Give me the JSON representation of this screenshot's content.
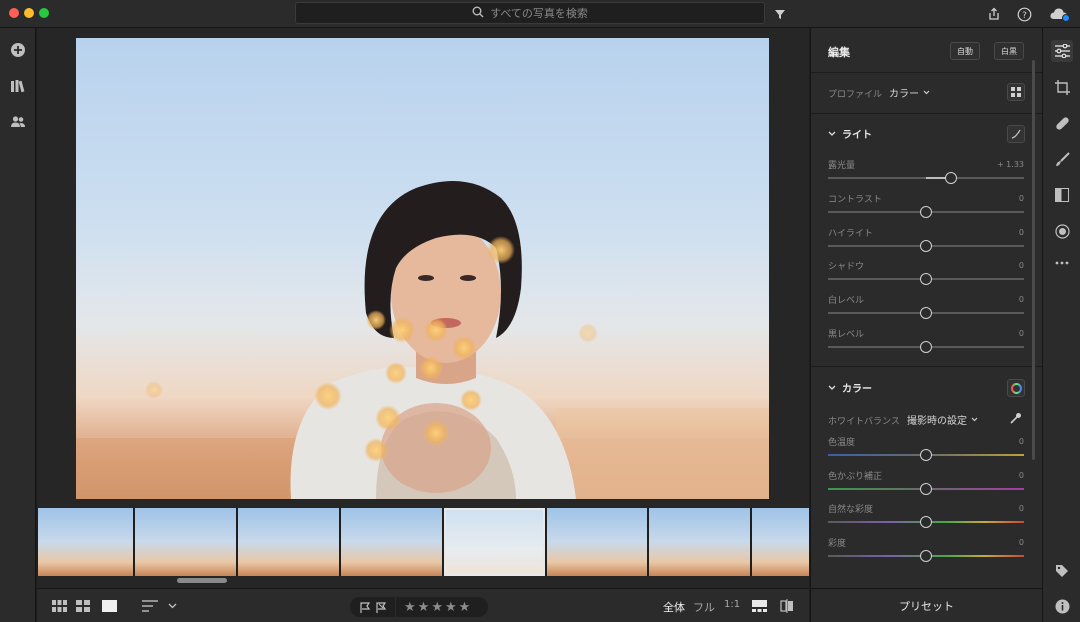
{
  "search": {
    "placeholder": "すべての写真を検索"
  },
  "colors": {
    "panel": "#2b2b2b",
    "accent": "#e8e8e8",
    "red": "#fe5f57",
    "yellow": "#febc2e",
    "green": "#28c840"
  },
  "edit_panel": {
    "title": "編集",
    "auto_label": "自動",
    "bw_label": "白黒",
    "profile_label": "プロファイル",
    "profile_value": "カラー",
    "light_section": {
      "title": "ライト",
      "sliders": [
        {
          "label": "露光量",
          "value": "+ 1.33",
          "position": 0.63
        },
        {
          "label": "コントラスト",
          "value": "0",
          "position": 0.5
        },
        {
          "label": "ハイライト",
          "value": "0",
          "position": 0.5
        },
        {
          "label": "シャドウ",
          "value": "0",
          "position": 0.5
        },
        {
          "label": "白レベル",
          "value": "0",
          "position": 0.5
        },
        {
          "label": "黒レベル",
          "value": "0",
          "position": 0.5
        }
      ]
    },
    "color_section": {
      "title": "カラー",
      "wb_label": "ホワイトバランス",
      "wb_value": "撮影時の設定",
      "sliders": [
        {
          "label": "色温度",
          "value": "0",
          "position": 0.5
        },
        {
          "label": "色かぶり補正",
          "value": "0",
          "position": 0.5
        },
        {
          "label": "自然な彩度",
          "value": "0",
          "position": 0.5
        },
        {
          "label": "彩度",
          "value": "0",
          "position": 0.5
        }
      ]
    }
  },
  "preset_label": "プリセット",
  "bottom": {
    "zoom_fit": "全体",
    "zoom_full": "フル",
    "zoom_1to1": "1:1"
  },
  "icons": {
    "left_rail": [
      "add-icon",
      "library-icon",
      "people-icon"
    ],
    "right_rail": [
      "sliders-icon",
      "crop-icon",
      "healing-icon",
      "brush-icon",
      "gradient-icon",
      "radial-icon",
      "more-icon",
      "tag-icon",
      "info-icon"
    ]
  }
}
